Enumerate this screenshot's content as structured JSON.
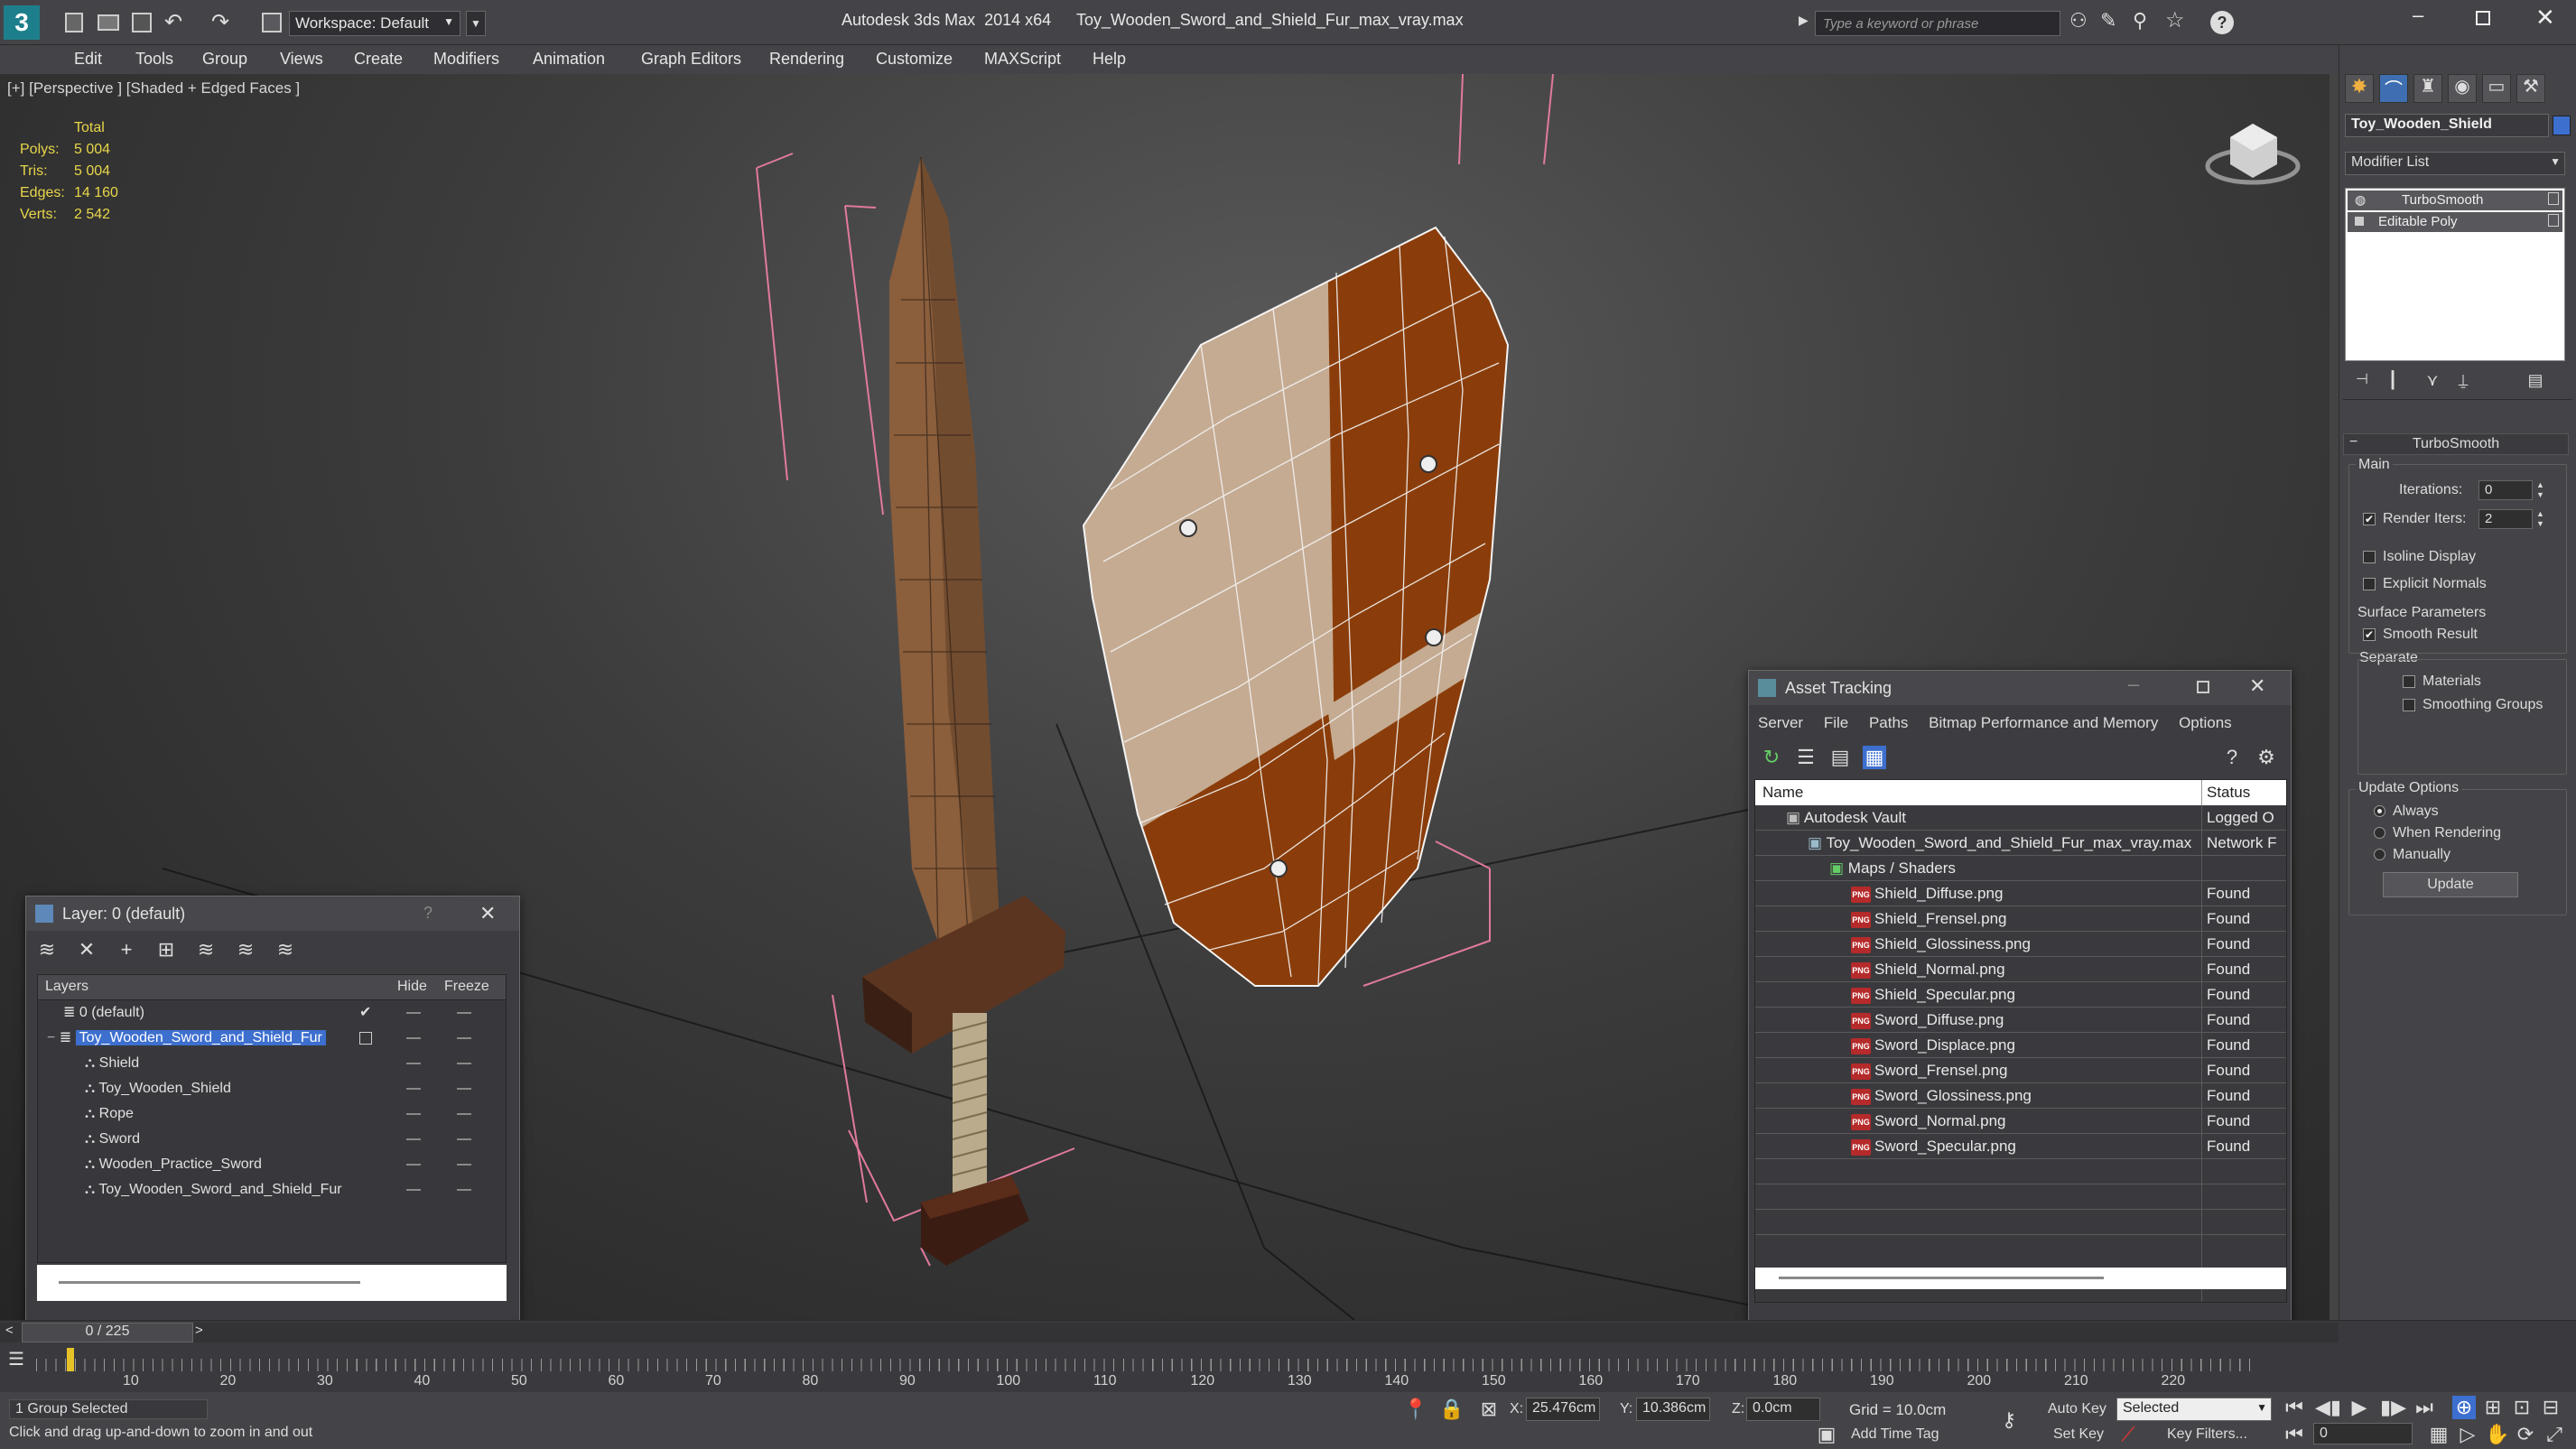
{
  "app": {
    "title": "Autodesk 3ds Max  2014 x64",
    "file": "Toy_Wooden_Sword_and_Shield_Fur_max_vray.max",
    "workspace": "Workspace: Default",
    "search_placeholder": "Type a keyword or phrase"
  },
  "menu": [
    "Edit",
    "Tools",
    "Group",
    "Views",
    "Create",
    "Modifiers",
    "Animation",
    "Graph Editors",
    "Rendering",
    "Customize",
    "MAXScript",
    "Help"
  ],
  "viewport": {
    "label": "[+] [Perspective ] [Shaded + Edged Faces ]",
    "stats": {
      "header": "Total",
      "rows": [
        {
          "label": "Polys:",
          "value": "5 004"
        },
        {
          "label": "Tris:",
          "value": "5 004"
        },
        {
          "label": "Edges:",
          "value": "14 160"
        },
        {
          "label": "Verts:",
          "value": "2 542"
        }
      ]
    }
  },
  "command_panel": {
    "object_name": "Toy_Wooden_Shield",
    "modifier_list": "Modifier List",
    "stack": [
      "TurboSmooth",
      "Editable Poly"
    ],
    "rollout_title": "TurboSmooth",
    "main_label": "Main",
    "iterations_label": "Iterations:",
    "iterations_value": "0",
    "render_iters_label": "Render Iters:",
    "render_iters_value": "2",
    "isoline": "Isoline Display",
    "explicit_normals": "Explicit Normals",
    "surface_params": "Surface Parameters",
    "smooth_result": "Smooth Result",
    "separate": "Separate",
    "materials": "Materials",
    "smoothing_groups": "Smoothing Groups",
    "update_options": "Update Options",
    "always": "Always",
    "when_rendering": "When Rendering",
    "manually": "Manually",
    "update_button": "Update"
  },
  "layer_window": {
    "title": "Layer: 0 (default)",
    "help": "?",
    "columns": {
      "layers": "Layers",
      "hide": "Hide",
      "freeze": "Freeze"
    },
    "rows": [
      {
        "name": "0 (default)",
        "indent": 0
      },
      {
        "name": "Toy_Wooden_Sword_and_Shield_Fur",
        "indent": 0,
        "selected": true
      },
      {
        "name": "Shield",
        "indent": 1
      },
      {
        "name": "Toy_Wooden_Shield",
        "indent": 1
      },
      {
        "name": "Rope",
        "indent": 1
      },
      {
        "name": "Sword",
        "indent": 1
      },
      {
        "name": "Wooden_Practice_Sword",
        "indent": 1
      },
      {
        "name": "Toy_Wooden_Sword_and_Shield_Fur",
        "indent": 1
      }
    ]
  },
  "asset_window": {
    "title": "Asset Tracking",
    "menu": [
      "Server",
      "File",
      "Paths",
      "Bitmap Performance and Memory",
      "Options"
    ],
    "columns": {
      "name": "Name",
      "status": "Status"
    },
    "rows": [
      {
        "name": "Autodesk Vault",
        "status": "Logged O",
        "level": 0,
        "icon": "vault"
      },
      {
        "name": "Toy_Wooden_Sword_and_Shield_Fur_max_vray.max",
        "status": "Network F",
        "level": 1,
        "icon": "max"
      },
      {
        "name": "Maps / Shaders",
        "status": "",
        "level": 2,
        "icon": "maps"
      },
      {
        "name": "Shield_Diffuse.png",
        "status": "Found",
        "level": 3,
        "icon": "png"
      },
      {
        "name": "Shield_Frensel.png",
        "status": "Found",
        "level": 3,
        "icon": "png"
      },
      {
        "name": "Shield_Glossiness.png",
        "status": "Found",
        "level": 3,
        "icon": "png"
      },
      {
        "name": "Shield_Normal.png",
        "status": "Found",
        "level": 3,
        "icon": "png"
      },
      {
        "name": "Shield_Specular.png",
        "status": "Found",
        "level": 3,
        "icon": "png"
      },
      {
        "name": "Sword_Diffuse.png",
        "status": "Found",
        "level": 3,
        "icon": "png"
      },
      {
        "name": "Sword_Displace.png",
        "status": "Found",
        "level": 3,
        "icon": "png"
      },
      {
        "name": "Sword_Frensel.png",
        "status": "Found",
        "level": 3,
        "icon": "png"
      },
      {
        "name": "Sword_Glossiness.png",
        "status": "Found",
        "level": 3,
        "icon": "png"
      },
      {
        "name": "Sword_Normal.png",
        "status": "Found",
        "level": 3,
        "icon": "png"
      },
      {
        "name": "Sword_Specular.png",
        "status": "Found",
        "level": 3,
        "icon": "png"
      }
    ]
  },
  "timeline": {
    "frame": "0 / 225",
    "ticks": [
      "10",
      "20",
      "30",
      "40",
      "50",
      "60",
      "70",
      "80",
      "90",
      "100",
      "110",
      "120",
      "130",
      "140",
      "150",
      "160",
      "170",
      "180",
      "190",
      "200",
      "210",
      "220"
    ]
  },
  "status": {
    "selection": "1 Group Selected",
    "prompt": "Click and drag up-and-down to zoom in and out",
    "x_label": "X:",
    "x": "25.476cm",
    "y_label": "Y:",
    "y": "10.386cm",
    "z_label": "Z:",
    "z": "0.0cm",
    "grid": "Grid = 10.0cm",
    "add_time_tag": "Add Time Tag",
    "auto_key": "Auto Key",
    "set_key": "Set Key",
    "selected": "Selected",
    "key_filters": "Key Filters...",
    "frame_field": "0"
  }
}
